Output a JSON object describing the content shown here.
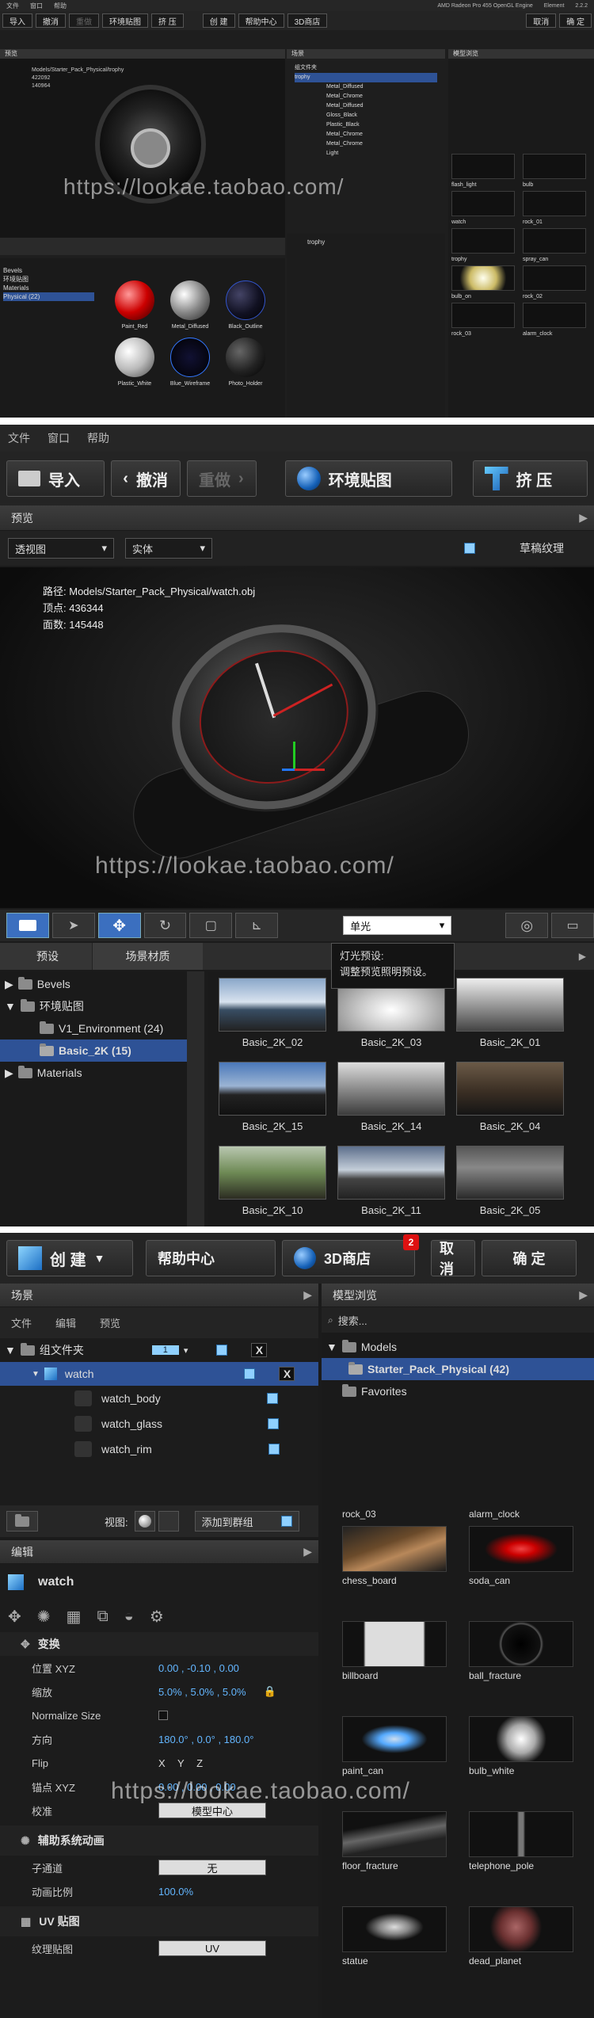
{
  "watermark": "https://lookae.taobao.com/",
  "overview": {
    "menu": [
      "文件",
      "窗口",
      "帮助"
    ],
    "right_info": "AMD Radeon Pro 455 OpenGL Engine",
    "app_name": "Element",
    "version": "2.2.2",
    "toolbar": {
      "import": "导入",
      "undo": "撤消",
      "redo": "重做",
      "env": "环境贴图",
      "extrude": "挤 压",
      "create": "创 建",
      "help": "帮助中心",
      "store": "3D商店",
      "cancel": "取消",
      "ok": "确 定"
    },
    "preview_title": "预览",
    "scene_title": "场景",
    "model_title": "模型浏览",
    "info": {
      "path": "Models/Starter_Pack_Physical/trophy",
      "verts": "422092",
      "faces": "140964"
    },
    "scene_items": [
      "组文件夹",
      "trophy",
      "Metal_Diffused",
      "Metal_Chrome",
      "Metal_Diffused",
      "Gloss_Black",
      "Plastic_Black",
      "Metal_Chrome",
      "Metal_Chrome",
      "Light"
    ],
    "material_items": [
      "Paint_Red",
      "Metal_Diffused",
      "Black_Outline",
      "Plastic_White",
      "Blue_Wireframe",
      "Photo_Holder"
    ],
    "tree": [
      "Bevels",
      "环境贴图",
      "Materials",
      "Physical (22)"
    ],
    "model_items": [
      "flash_light",
      "bulb",
      "watch",
      "rock_01",
      "trophy",
      "spray_can",
      "bulb_on",
      "rock_02",
      "rock_03",
      "alarm_clock"
    ],
    "edit_name": "trophy"
  },
  "preview": {
    "menu": [
      "文件",
      "窗口",
      "帮助"
    ],
    "toolbar": {
      "import": "导入",
      "undo": "撤消",
      "redo": "重做",
      "env": "环境贴图",
      "extrude": "挤 压"
    },
    "panel_title": "预览",
    "view_dd": "透视图",
    "shade_dd": "实体",
    "draft_label": "草稿纹理",
    "info_labels": {
      "path": "路径:",
      "verts": "顶点:",
      "faces": "面数:"
    },
    "info": {
      "path": "Models/Starter_Pack_Physical/watch.obj",
      "verts": "436344",
      "faces": "145448"
    },
    "light_dd": "单光",
    "tooltip": {
      "title": "灯光预设:",
      "body": "调整预览照明预设。"
    },
    "tabs": {
      "preset": "预设",
      "scene_mat": "场景材质"
    },
    "tree": [
      {
        "label": "Bevels",
        "level": 0
      },
      {
        "label": "环境贴图",
        "level": 0
      },
      {
        "label": "V1_Environment (24)",
        "level": 1
      },
      {
        "label": "Basic_2K (15)",
        "level": 1,
        "selected": true
      },
      {
        "label": "Materials",
        "level": 0
      }
    ],
    "env_thumbs": [
      "Basic_2K_02",
      "Basic_2K_03",
      "Basic_2K_01",
      "Basic_2K_15",
      "Basic_2K_14",
      "Basic_2K_04",
      "Basic_2K_10",
      "Basic_2K_11",
      "Basic_2K_05"
    ]
  },
  "scene": {
    "toolbar": {
      "create": "创 建",
      "help": "帮助中心",
      "store": "3D商店",
      "store_badge": "2",
      "cancel": "取消",
      "ok": "确 定"
    },
    "scene_title": "场景",
    "scene_menu": [
      "文件",
      "编辑",
      "预览"
    ],
    "group": {
      "label": "组文件夹",
      "count": "1"
    },
    "items": [
      {
        "label": "watch",
        "selected": true
      },
      {
        "label": "watch_body"
      },
      {
        "label": "watch_glass"
      },
      {
        "label": "watch_rim"
      }
    ],
    "x": "X",
    "view_label": "视图:",
    "add_group": "添加到群组",
    "edit_title": "编辑",
    "edit_name": "watch",
    "transform_title": "变换",
    "props": [
      {
        "k": "位置 XYZ",
        "v": "0.00 ,  -0.10 ,  0.00"
      },
      {
        "k": "缩放",
        "v": "5.0% ,  5.0% ,  5.0%"
      },
      {
        "k": "Normalize Size",
        "v": ""
      },
      {
        "k": "方向",
        "v": "180.0° ,  0.0° ,  180.0°"
      },
      {
        "k": "Flip",
        "v": "X   Y   Z"
      },
      {
        "k": "锚点 XYZ",
        "v": "0.00 ,  0.00 ,  0.00"
      },
      {
        "k": "校准",
        "v": "模型中心"
      }
    ],
    "anim_title": "辅助系统动画",
    "anim_props": [
      {
        "k": "子通道",
        "v": "无"
      },
      {
        "k": "动画比例",
        "v": "100.0%"
      }
    ],
    "uv_title": "UV 贴图",
    "uv_props": [
      {
        "k": "纹理贴图",
        "v": "UV"
      }
    ],
    "model_title": "模型浏览",
    "search_placeholder": "搜索...",
    "model_tree": [
      {
        "label": "Models",
        "level": 0
      },
      {
        "label": "Starter_Pack_Physical (42)",
        "level": 1,
        "selected": true
      },
      {
        "label": "Favorites",
        "level": 0
      }
    ],
    "models": [
      "rock_03",
      "alarm_clock",
      "chess_board",
      "soda_can",
      "billboard",
      "ball_fracture",
      "paint_can",
      "bulb_white",
      "floor_fracture",
      "telephone_pole",
      "statue",
      "dead_planet"
    ]
  }
}
